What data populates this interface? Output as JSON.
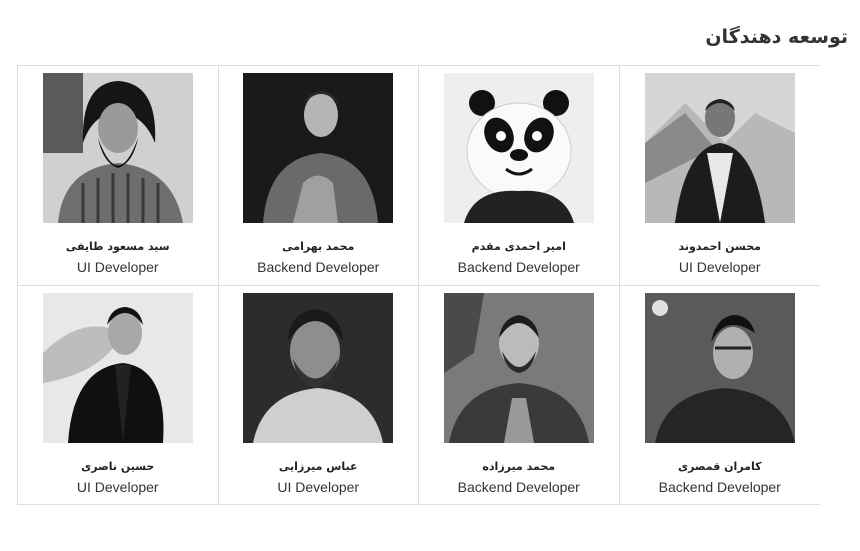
{
  "section": {
    "title": "توسعه دهندگان"
  },
  "team": [
    {
      "name": "محسن احمدوند",
      "role": "UI Developer",
      "photo_icon": "person-photo-icon"
    },
    {
      "name": "امیر احمدی مقدم",
      "role": "Backend Developer",
      "photo_icon": "panda-photo-icon"
    },
    {
      "name": "محمد بهرامی",
      "role": "Backend Developer",
      "photo_icon": "person-photo-icon"
    },
    {
      "name": "سید مسعود طایفی",
      "role": "UI Developer",
      "photo_icon": "person-photo-icon"
    },
    {
      "name": "کامران قمصری",
      "role": "Backend Developer",
      "photo_icon": "person-photo-icon"
    },
    {
      "name": "محمد میرزاده",
      "role": "Backend Developer",
      "photo_icon": "person-photo-icon"
    },
    {
      "name": "عباس میرزایی",
      "role": "UI Developer",
      "photo_icon": "person-photo-icon"
    },
    {
      "name": "حسین ناصری",
      "role": "UI Developer",
      "photo_icon": "person-photo-icon"
    }
  ]
}
